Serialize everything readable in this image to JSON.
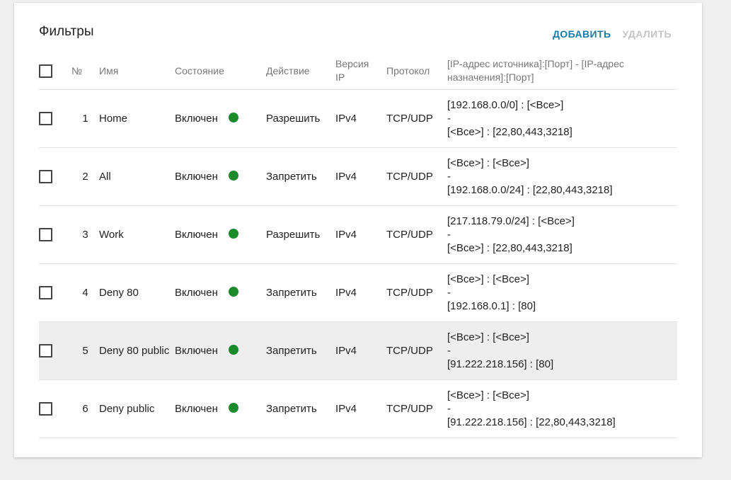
{
  "page": {
    "title": "Фильтры",
    "add_label": "ДОБАВИТЬ",
    "delete_label": "УДАЛИТЬ"
  },
  "columns": {
    "num": "№",
    "name": "Имя",
    "state": "Состояние",
    "action": "Действие",
    "version_line1": "Версия",
    "version_line2": "IP",
    "protocol": "Протокол",
    "address_line1": "[IP-адрес источника]:[Порт] - [IP-адрес",
    "address_line2": "назначения]:[Порт]"
  },
  "rows": [
    {
      "num": "1",
      "name": "Home",
      "state": "Включен",
      "action": "Разрешить",
      "version": "IPv4",
      "protocol": "TCP/UDP",
      "src": "[192.168.0.0/0] : [<Все>]",
      "sep": "-",
      "dst": "[<Все>] : [22,80,443,3218]"
    },
    {
      "num": "2",
      "name": "All",
      "state": "Включен",
      "action": "Запретить",
      "version": "IPv4",
      "protocol": "TCP/UDP",
      "src": "[<Все>] : [<Все>]",
      "sep": "-",
      "dst": "[192.168.0.0/24] : [22,80,443,3218]"
    },
    {
      "num": "3",
      "name": "Work",
      "state": "Включен",
      "action": "Разрешить",
      "version": "IPv4",
      "protocol": "TCP/UDP",
      "src": "[217.118.79.0/24] : [<Все>]",
      "sep": "-",
      "dst": "[<Все>] : [22,80,443,3218]"
    },
    {
      "num": "4",
      "name": "Deny 80",
      "state": "Включен",
      "action": "Запретить",
      "version": "IPv4",
      "protocol": "TCP/UDP",
      "src": "[<Все>] : [<Все>]",
      "sep": "-",
      "dst": "[192.168.0.1] : [80]"
    },
    {
      "num": "5",
      "name": "Deny 80 public",
      "state": "Включен",
      "action": "Запретить",
      "version": "IPv4",
      "protocol": "TCP/UDP",
      "src": "[<Все>] : [<Все>]",
      "sep": "-",
      "dst": "[91.222.218.156] : [80]"
    },
    {
      "num": "6",
      "name": "Deny public",
      "state": "Включен",
      "action": "Запретить",
      "version": "IPv4",
      "protocol": "TCP/UDP",
      "src": "[<Все>] : [<Все>]",
      "sep": "-",
      "dst": "[91.222.218.156] : [22,80,443,3218]"
    }
  ],
  "colors": {
    "accent": "#1a7aa3",
    "status_on": "#1a8a2b",
    "disabled": "#c4c4c4",
    "row_highlight": "#eeeeee"
  }
}
